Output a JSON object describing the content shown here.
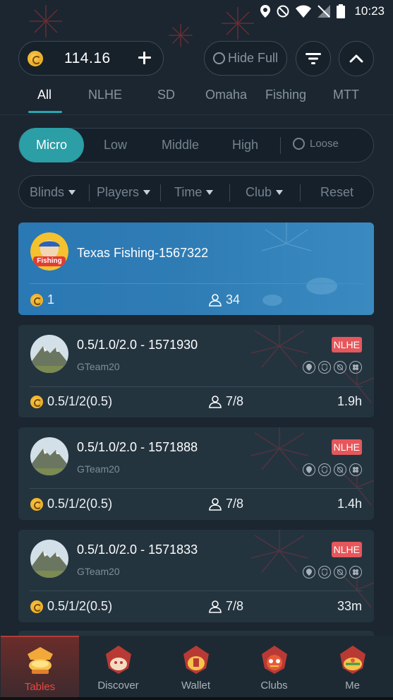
{
  "status_bar": {
    "time": "10:23"
  },
  "header": {
    "balance": "114.16",
    "hide_full_label": "Hide Full"
  },
  "tabs": [
    "All",
    "NLHE",
    "SD",
    "Omaha",
    "Fishing",
    "MTT"
  ],
  "levels": {
    "active": "Micro",
    "items": [
      "Low",
      "Middle",
      "High"
    ],
    "loose_label": "Loose"
  },
  "filters": {
    "blinds": "Blinds",
    "players": "Players",
    "time": "Time",
    "club": "Club",
    "reset": "Reset"
  },
  "featured": {
    "title": "Texas Fishing-1567322",
    "avatar_text": "Fishing",
    "buyin": "1",
    "players": "34"
  },
  "tables": [
    {
      "title": "0.5/1.0/2.0 - 1571930",
      "club": "GTeam20",
      "badge": "NLHE",
      "blinds": "0.5/1/2(0.5)",
      "players": "7/8",
      "time": "1.9h"
    },
    {
      "title": "0.5/1.0/2.0 - 1571888",
      "club": "GTeam20",
      "badge": "NLHE",
      "blinds": "0.5/1/2(0.5)",
      "players": "7/8",
      "time": "1.4h"
    },
    {
      "title": "0.5/1.0/2.0 - 1571833",
      "club": "GTeam20",
      "badge": "NLHE",
      "blinds": "0.5/1/2(0.5)",
      "players": "7/8",
      "time": "33m"
    }
  ],
  "nav": [
    "Tables",
    "Discover",
    "Wallet",
    "Clubs",
    "Me"
  ],
  "colors": {
    "background": "#1b2630",
    "accent": "#2b9ea6",
    "badge": "#e5575b",
    "nav_active": "#e8483f",
    "featured": "#2f7cb5"
  }
}
